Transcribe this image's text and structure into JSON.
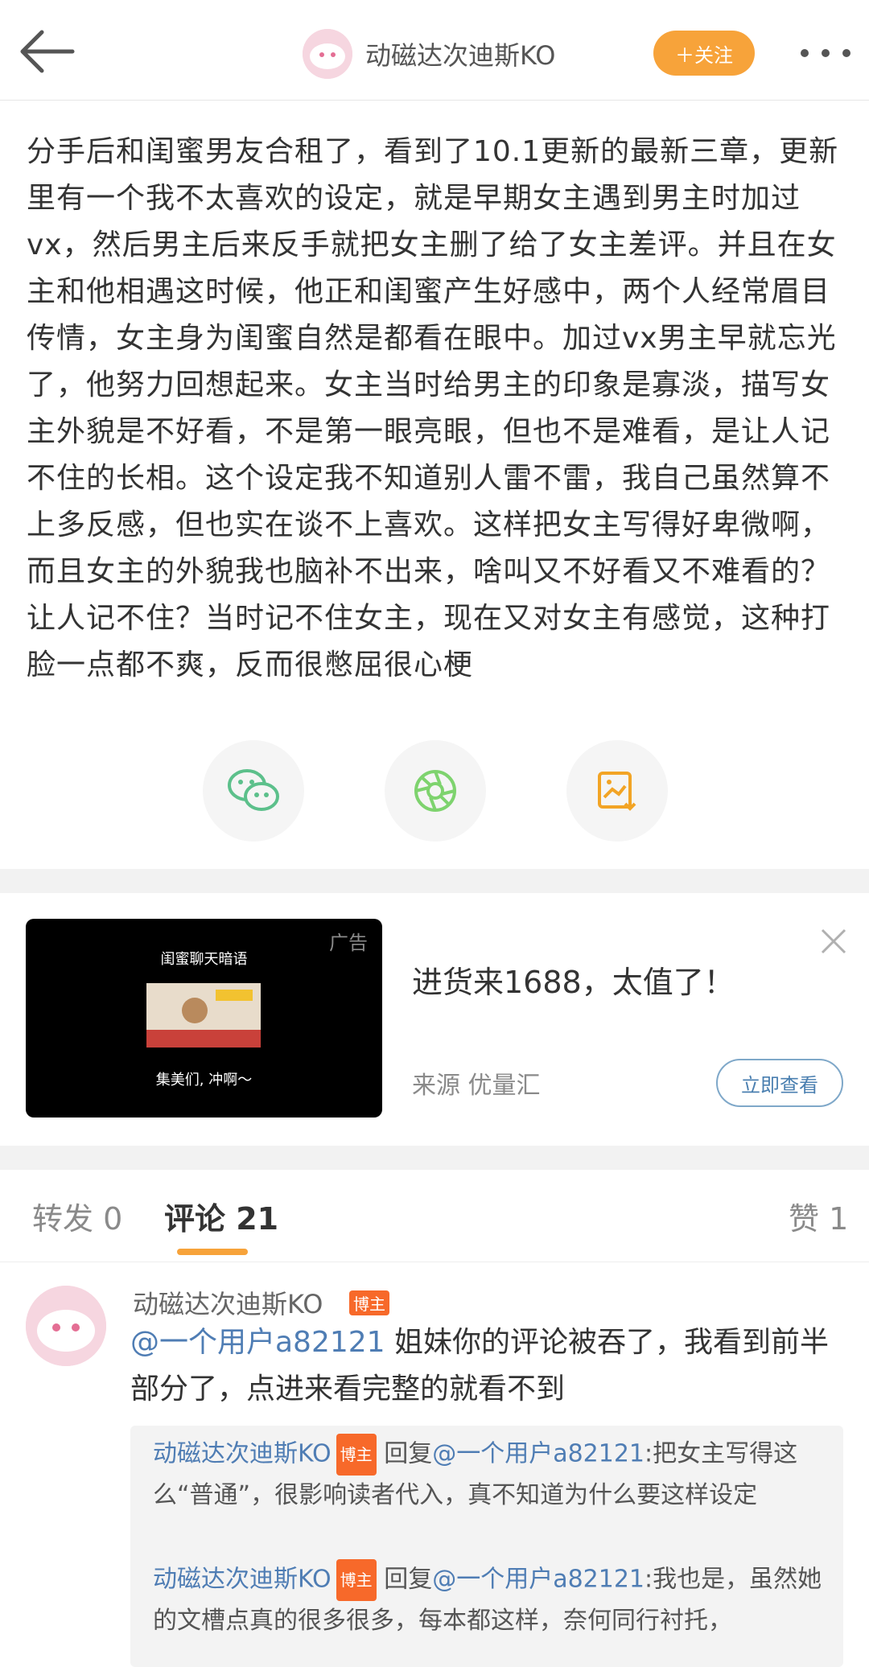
{
  "header": {
    "author_name": "动磁达次迪斯KO",
    "follow_label": "＋关注"
  },
  "post": {
    "text": "分手后和闺蜜男友合租了，看到了10.1更新的最新三章，更新里有一个我不太喜欢的设定，就是早期女主遇到男主时加过vx，然后男主后来反手就把女主删了给了女主差评。并且在女主和他相遇这时候，他正和闺蜜产生好感中，两个人经常眉目传情，女主身为闺蜜自然是都看在眼中。加过vx男主早就忘光了，他努力回想起来。女主当时给男主的印象是寡淡，描写女主外貌是不好看，不是第一眼亮眼，但也不是难看，是让人记不住的长相。这个设定我不知道别人雷不雷，我自己虽然算不上多反感，但也实在谈不上喜欢。这样把女主写得好卑微啊，而且女主的外貌我也脑补不出来，啥叫又不好看又不难看的？让人记不住？当时记不住女主，现在又对女主有感觉，这种打脸一点都不爽，反而很憋屈很心梗"
  },
  "share": {
    "icons": [
      "wechat-icon",
      "moments-icon",
      "save-image-icon"
    ]
  },
  "ad": {
    "tag": "广告",
    "caption_top": "闺蜜聊天暗语",
    "caption_bottom": "集美们, 冲啊～",
    "title": "进货来1688，太值了！",
    "source": "来源 优量汇",
    "cta": "立即查看"
  },
  "tabs": {
    "repost": "转发 0",
    "comment": "评论 21",
    "like": "赞 1"
  },
  "comment": {
    "author": "动磁达次迪斯KO",
    "badge": "博主",
    "mention": "@一个用户a82121",
    "text": " 姐妹你的评论被吞了，我看到前半部分了，点进来看完整的就看不到",
    "replies": [
      {
        "author": "动磁达次迪斯KO",
        "badge": "博主",
        "reply_prefix": " 回复",
        "mention": "@一个用户a82121",
        "text": ":把女主写得这么“普通”，很影响读者代入，真不知道为什么要这样设定"
      },
      {
        "author": "动磁达次迪斯KO",
        "badge": "博主",
        "reply_prefix": " 回复",
        "mention": "@一个用户a82121",
        "text": ":我也是，虽然她的文槽点真的很多很多，每本都这样，奈何同行衬托，"
      }
    ]
  },
  "colors": {
    "accent_orange": "#f7a33a",
    "link_blue": "#4f7db4",
    "badge_orange": "#f7692a"
  }
}
